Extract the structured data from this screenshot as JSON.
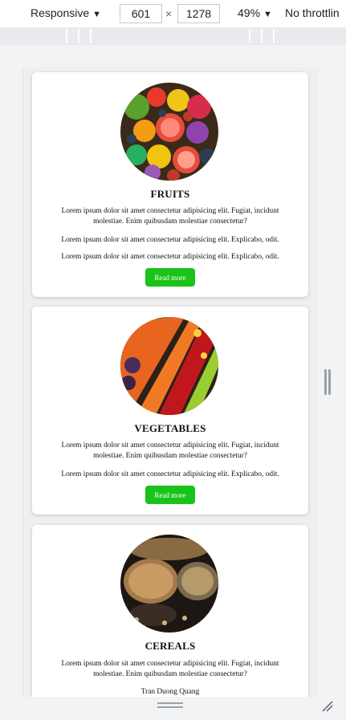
{
  "toolbar": {
    "device": "Responsive",
    "width": "601",
    "times": "×",
    "height": "1278",
    "zoom": "49%",
    "throttle": "No throttlin"
  },
  "cards": [
    {
      "title": "FRUITS",
      "paragraphs": [
        "Lorem ipsum dolor sit amet consectetur adipisicing elit. Fugiat, incidunt molestiae. Enim quibusdam molestiae consectetur?",
        "Lorem ipsum dolor sit amet consectetur adipisicing elit. Explicabo, odit.",
        "Lorem ipsum dolor sit amet consectetur adipisicing elit. Explicabo, odit."
      ],
      "button": "Read more"
    },
    {
      "title": "VEGETABLES",
      "paragraphs": [
        "Lorem ipsum dolor sit amet consectetur adipisicing elit. Fugiat, incidunt molestiae. Enim quibusdam molestiae consectetur?",
        "Lorem ipsum dolor sit amet consectetur adipisicing elit. Explicabo, odit."
      ],
      "button": "Read more"
    },
    {
      "title": "CEREALS",
      "paragraphs": [
        "Lorem ipsum dolor sit amet consectetur adipisicing elit. Fugiat, incidunt molestiae. Enim quibusdam molestiae consectetur?"
      ],
      "footer": "Tran Duong Quang"
    }
  ],
  "colors": {
    "button_green": "#19c319",
    "page_bg": "#efefef",
    "card_bg": "#ffffff"
  },
  "icons": {
    "device_caret": "caret-down-icon",
    "zoom_caret": "caret-down-icon",
    "resize_corner": "resize-corner-icon"
  }
}
